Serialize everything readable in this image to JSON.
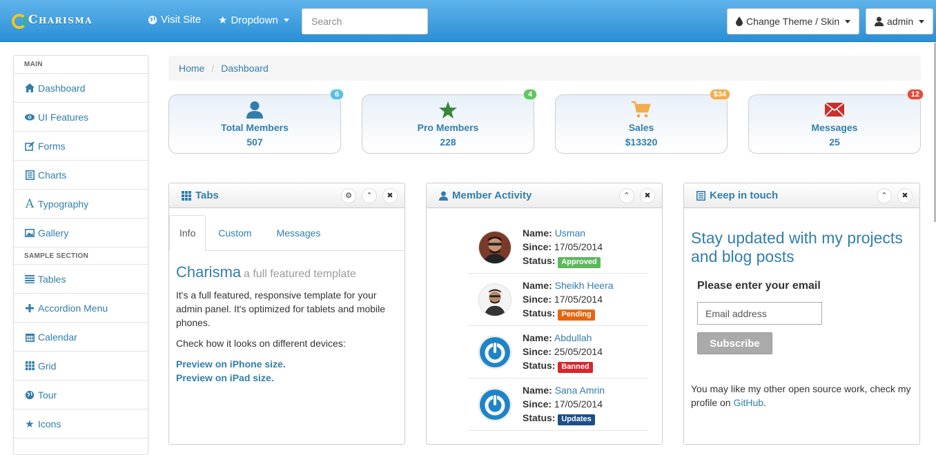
{
  "navbar": {
    "brand": "Charisma",
    "visit_site": "Visit Site",
    "dropdown": "Dropdown",
    "search_placeholder": "Search",
    "theme_button": "Change Theme / Skin",
    "user_button": "admin"
  },
  "sidebar": {
    "main_header": "MAIN",
    "sample_header": "SAMPLE SECTION",
    "main_items": [
      {
        "label": "Dashboard",
        "icon": "home-icon"
      },
      {
        "label": "UI Features",
        "icon": "eye-icon"
      },
      {
        "label": "Forms",
        "icon": "edit-icon"
      },
      {
        "label": "Charts",
        "icon": "list-alt-icon"
      },
      {
        "label": "Typography",
        "icon": "font-icon"
      },
      {
        "label": "Gallery",
        "icon": "picture-icon"
      }
    ],
    "sample_items": [
      {
        "label": "Tables",
        "icon": "align-justify-icon"
      },
      {
        "label": "Accordion Menu",
        "icon": "plus-icon"
      },
      {
        "label": "Calendar",
        "icon": "calendar-icon"
      },
      {
        "label": "Grid",
        "icon": "th-icon"
      },
      {
        "label": "Tour",
        "icon": "globe-icon"
      },
      {
        "label": "Icons",
        "icon": "star-icon"
      }
    ]
  },
  "breadcrumb": {
    "home": "Home",
    "current": "Dashboard"
  },
  "stats": [
    {
      "label": "Total Members",
      "value": "507",
      "badge": "6",
      "badge_color": "#5bc0de",
      "icon_color": "#317eac",
      "icon": "user-icon"
    },
    {
      "label": "Pro Members",
      "value": "228",
      "badge": "4",
      "badge_color": "#62c462",
      "icon_color": "#3a873a",
      "icon": "star-icon"
    },
    {
      "label": "Sales",
      "value": "$13320",
      "badge": "$34",
      "badge_color": "#f0ad4e",
      "icon_color": "#f0ad4e",
      "icon": "shopping-cart-icon"
    },
    {
      "label": "Messages",
      "value": "25",
      "badge": "12",
      "badge_color": "#e04b3a",
      "icon_color": "#c9302c",
      "icon": "envelope-icon"
    }
  ],
  "tabs_panel": {
    "title": "Tabs",
    "tabs": [
      "Info",
      "Custom",
      "Messages"
    ],
    "heading": "Charisma",
    "subheading": "a full featured template",
    "para1": "It's a full featured, responsive template for your admin panel. It's optimized for tablets and mobile phones.",
    "para2": "Check how it looks on different devices:",
    "link1": "Preview on iPhone size.",
    "link2": "Preview on iPad size."
  },
  "activity_panel": {
    "title": "Member Activity",
    "name_label": "Name:",
    "since_label": "Since:",
    "status_label": "Status:",
    "members": [
      {
        "name": "Usman",
        "since": "17/05/2014",
        "status": "Approved",
        "status_color": "#5cb85c",
        "avatar": "photo"
      },
      {
        "name": "Sheikh Heera",
        "since": "17/05/2014",
        "status": "Pending",
        "status_color": "#e8650a",
        "avatar": "photo"
      },
      {
        "name": "Abdullah",
        "since": "25/05/2014",
        "status": "Banned",
        "status_color": "#d9262b",
        "avatar": "power"
      },
      {
        "name": "Sana Amrin",
        "since": "17/05/2014",
        "status": "Updates",
        "status_color": "#1b4f8a",
        "avatar": "power"
      }
    ]
  },
  "touch_panel": {
    "title": "Keep in touch",
    "heading": "Stay updated with my projects and blog posts",
    "email_label": "Please enter your email",
    "email_placeholder": "Email address",
    "subscribe": "Subscribe",
    "footer_text": "You may like my other open source work, check my profile on",
    "footer_link": "GitHub",
    "footer_end": "."
  }
}
